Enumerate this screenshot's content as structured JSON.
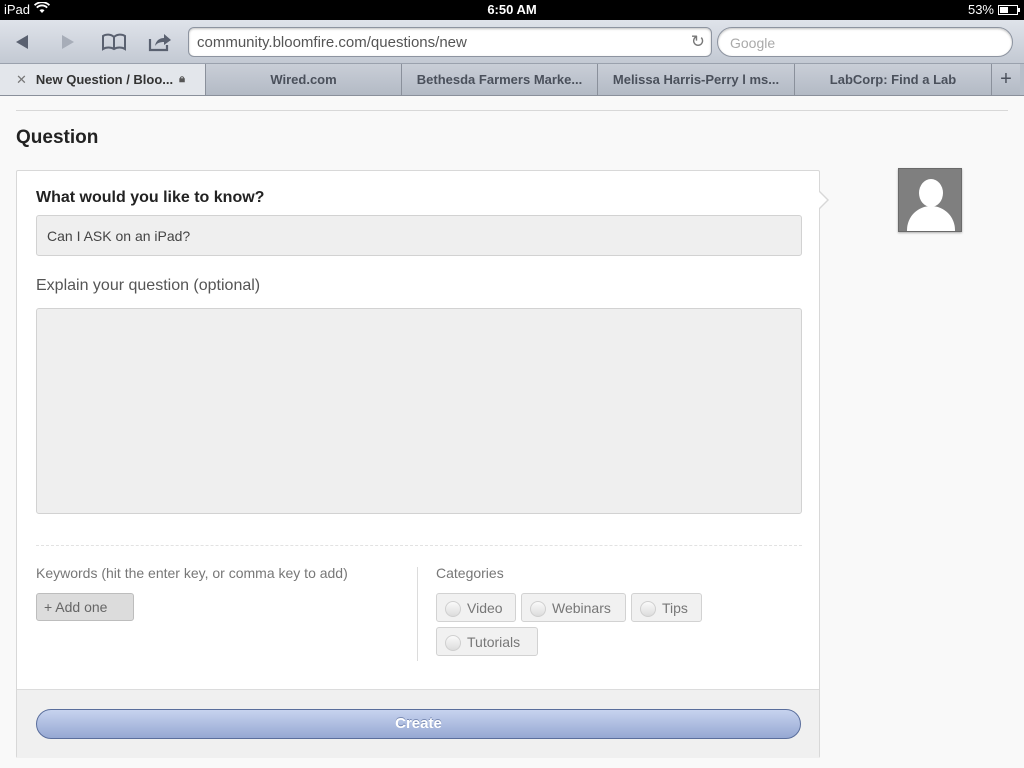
{
  "status_bar": {
    "device": "iPad",
    "time": "6:50 AM",
    "battery": "53%",
    "battery_level": 0.53,
    "wifi_icon": "wifi-icon"
  },
  "toolbar": {
    "back_icon": "back-arrow-icon",
    "forward_icon": "forward-arrow-icon",
    "bookmarks_icon": "bookmarks-book-icon",
    "share_icon": "share-icon",
    "url": "community.bloomfire.com/questions/new",
    "reload_icon": "reload-icon",
    "search_placeholder": "Google"
  },
  "tabs": [
    {
      "label": "New Question / Bloo...",
      "active": true
    },
    {
      "label": "Wired.com",
      "active": false
    },
    {
      "label": "Bethesda Farmers Marke...",
      "active": false
    },
    {
      "label": "Melissa Harris-Perry l ms...",
      "active": false
    },
    {
      "label": "LabCorp: Find a Lab",
      "active": false
    }
  ],
  "page": {
    "title": "Question",
    "question_label": "What would you like to know?",
    "question_value": "Can I ASK on an iPad?",
    "explain_label": "Explain your question (optional)",
    "explain_value": "",
    "keywords_label": "Keywords (hit the enter key, or comma key to add)",
    "keywords_add": "+ Add one",
    "categories_label": "Categories",
    "categories": [
      "Video",
      "Webinars",
      "Tips",
      "Tutorials"
    ],
    "create_label": "Create"
  },
  "colors": {
    "create_button": "#a9b9e0",
    "statusbar": "#000000",
    "toolbar": "#d2d7df"
  }
}
